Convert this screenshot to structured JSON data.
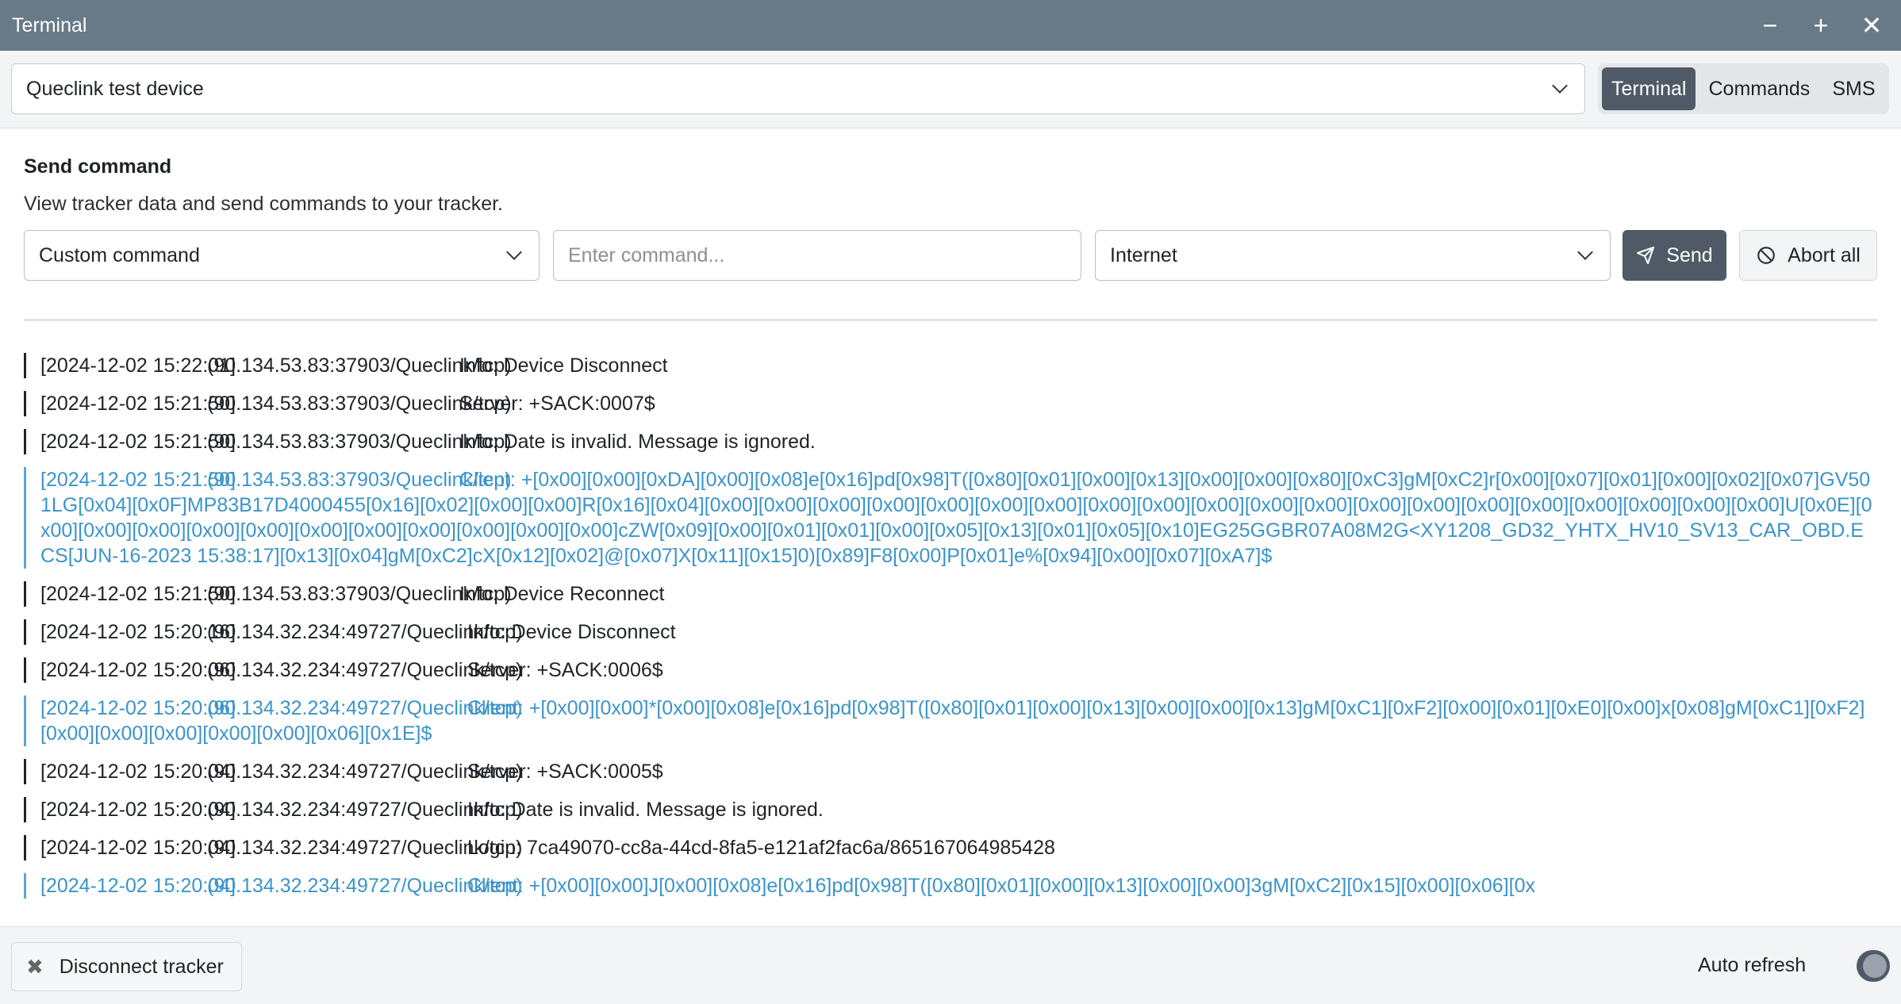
{
  "window": {
    "title": "Terminal",
    "controls": [
      "−",
      "+",
      "✕"
    ]
  },
  "device_select": {
    "value": "Queclink test device"
  },
  "tabs": [
    {
      "label": "Terminal",
      "active": true
    },
    {
      "label": "Commands",
      "active": false
    },
    {
      "label": "SMS",
      "active": false
    }
  ],
  "send": {
    "title": "Send command",
    "subtitle": "View tracker data and send commands to your tracker.",
    "command_type": "Custom command",
    "command_placeholder": "Enter command...",
    "channel": "Internet",
    "send_label": "Send",
    "abort_label": "Abort all"
  },
  "log": [
    {
      "ts": "[2024-12-02 15:22:01]",
      "src": "(90.134.53.83:37903/Queclink/tcp)",
      "msg": "Info: Device Disconnect",
      "type": "info"
    },
    {
      "ts": "[2024-12-02 15:21:50]",
      "src": "(90.134.53.83:37903/Queclink/tcp)",
      "msg": "Server: +SACK:0007$",
      "type": "server"
    },
    {
      "ts": "[2024-12-02 15:21:50]",
      "src": "(90.134.53.83:37903/Queclink/tcp)",
      "msg": "Info: Date is invalid. Message is ignored.",
      "type": "info"
    },
    {
      "ts": "[2024-12-02 15:21:50]",
      "src": "(90.134.53.83:37903/Queclink/tcp)",
      "msg": "Client: +[0x00][0x00][0xDA][0x00][0x08]e[0x16]pd[0x98]T([0x80][0x01][0x00][0x13][0x00][0x00][0x80][0xC3]gM[0xC2]r[0x00][0x07][0x01][0x00][0x02][0x07]GV501LG[0x04][0x0F]MP83B17D4000455[0x16][0x02][0x00][0x00]R[0x16][0x04][0x00][0x00][0x00][0x00][0x00][0x00][0x00][0x00][0x00][0x00][0x00][0x00][0x00][0x00][0x00][0x00][0x00][0x00][0x00][0x00]U[0x0E][0x00][0x00][0x00][0x00][0x00][0x00][0x00][0x00][0x00][0x00][0x00]cZW[0x09][0x00][0x01][0x01][0x00][0x05][0x13][0x01][0x05][0x10]EG25GGBR07A08M2G<XY1208_GD32_YHTX_HV10_SV13_CAR_OBD.ECS[JUN-16-2023 15:38:17][0x13][0x04]gM[0xC2]cX[0x12][0x02]@[0x07]X[0x11][0x15]0)[0x89]F8[0x00]P[0x01]e%[0x94][0x00][0x07][0xA7]$",
      "type": "client"
    },
    {
      "ts": "[2024-12-02 15:21:50]",
      "src": "(90.134.53.83:37903/Queclink/tcp)",
      "msg": "Info: Device Reconnect",
      "type": "info"
    },
    {
      "ts": "[2024-12-02 15:20:16]",
      "src": "(90.134.32.234:49727/Queclink/tcp)",
      "msg": "Info: Device Disconnect",
      "type": "info"
    },
    {
      "ts": "[2024-12-02 15:20:06]",
      "src": "(90.134.32.234:49727/Queclink/tcp)",
      "msg": "Server: +SACK:0006$",
      "type": "server"
    },
    {
      "ts": "[2024-12-02 15:20:06]",
      "src": "(90.134.32.234:49727/Queclink/tcp)",
      "msg": "Client: +[0x00][0x00]*[0x00][0x08]e[0x16]pd[0x98]T([0x80][0x01][0x00][0x13][0x00][0x00][0x13]gM[0xC1][0xF2][0x00][0x01][0xE0][0x00]x[0x08]gM[0xC1][0xF2][0x00][0x00][0x00][0x00][0x00][0x06][0x1E]$",
      "type": "client"
    },
    {
      "ts": "[2024-12-02 15:20:04]",
      "src": "(90.134.32.234:49727/Queclink/tcp)",
      "msg": "Server: +SACK:0005$",
      "type": "server"
    },
    {
      "ts": "[2024-12-02 15:20:04]",
      "src": "(90.134.32.234:49727/Queclink/tcp)",
      "msg": "Info: Date is invalid. Message is ignored.",
      "type": "info"
    },
    {
      "ts": "[2024-12-02 15:20:04]",
      "src": "(90.134.32.234:49727/Queclink/tcp)",
      "msg": "Login: 7ca49070-cc8a-44cd-8fa5-e121af2fac6a/865167064985428",
      "type": "info"
    },
    {
      "ts": "[2024-12-02 15:20:04]",
      "src": "(90.134.32.234:49727/Queclink/tcp)",
      "msg": "Client: +[0x00][0x00]J[0x00][0x08]e[0x16]pd[0x98]T([0x80][0x01][0x00][0x13][0x00][0x00]3gM[0xC2][0x15][0x00][0x06][0x",
      "type": "client"
    }
  ],
  "footer": {
    "disconnect_label": "Disconnect tracker",
    "auto_refresh_label": "Auto refresh",
    "auto_refresh_on": true
  },
  "colors": {
    "titlebar": "#687a88",
    "accent": "#4f5a66",
    "client_text": "#3b94c9"
  }
}
